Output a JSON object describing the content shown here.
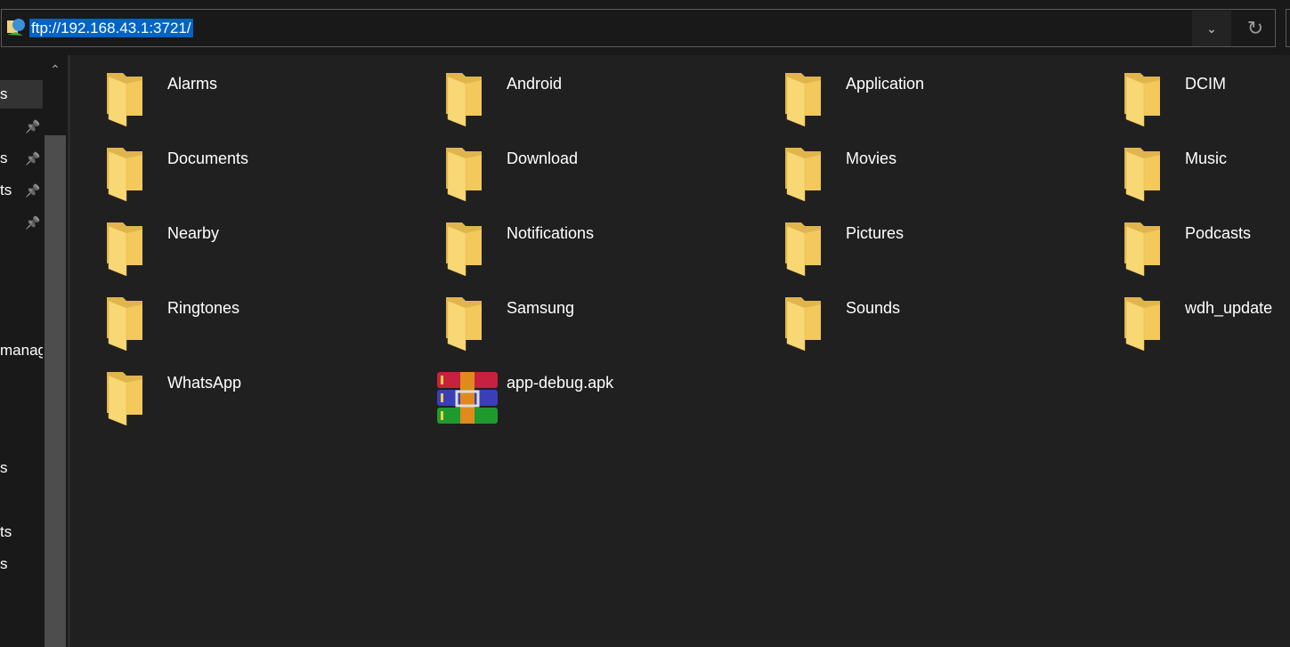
{
  "address_bar": {
    "url": "ftp://192.168.43.1:3721/",
    "location_icon": "ftp-network-icon",
    "dropdown_icon": "chevron-down-icon",
    "refresh_icon": "refresh-icon"
  },
  "sidebar": {
    "items": [
      {
        "label": "s",
        "selected": true,
        "pinned": false
      },
      {
        "label": "",
        "pinned": true
      },
      {
        "label": "s",
        "pinned": true
      },
      {
        "label": "ts",
        "pinned": true
      },
      {
        "label": "",
        "pinned": true
      },
      {
        "label": "manag",
        "pinned": false
      },
      {
        "label": "s",
        "pinned": false
      },
      {
        "label": "ts",
        "pinned": false
      },
      {
        "label": "s",
        "pinned": false
      }
    ]
  },
  "files": [
    {
      "name": "Alarms",
      "type": "folder"
    },
    {
      "name": "Android",
      "type": "folder"
    },
    {
      "name": "Application",
      "type": "folder"
    },
    {
      "name": "DCIM",
      "type": "folder"
    },
    {
      "name": "Documents",
      "type": "folder"
    },
    {
      "name": "Download",
      "type": "folder"
    },
    {
      "name": "Movies",
      "type": "folder"
    },
    {
      "name": "Music",
      "type": "folder"
    },
    {
      "name": "Nearby",
      "type": "folder"
    },
    {
      "name": "Notifications",
      "type": "folder"
    },
    {
      "name": "Pictures",
      "type": "folder"
    },
    {
      "name": "Podcasts",
      "type": "folder"
    },
    {
      "name": "Ringtones",
      "type": "folder"
    },
    {
      "name": "Samsung",
      "type": "folder"
    },
    {
      "name": "Sounds",
      "type": "folder"
    },
    {
      "name": "wdh_update",
      "type": "folder"
    },
    {
      "name": "WhatsApp",
      "type": "folder"
    },
    {
      "name": "app-debug.apk",
      "type": "archive"
    }
  ],
  "colors": {
    "selection": "#0063c6",
    "folder": "#f8d775",
    "background": "#202020"
  }
}
